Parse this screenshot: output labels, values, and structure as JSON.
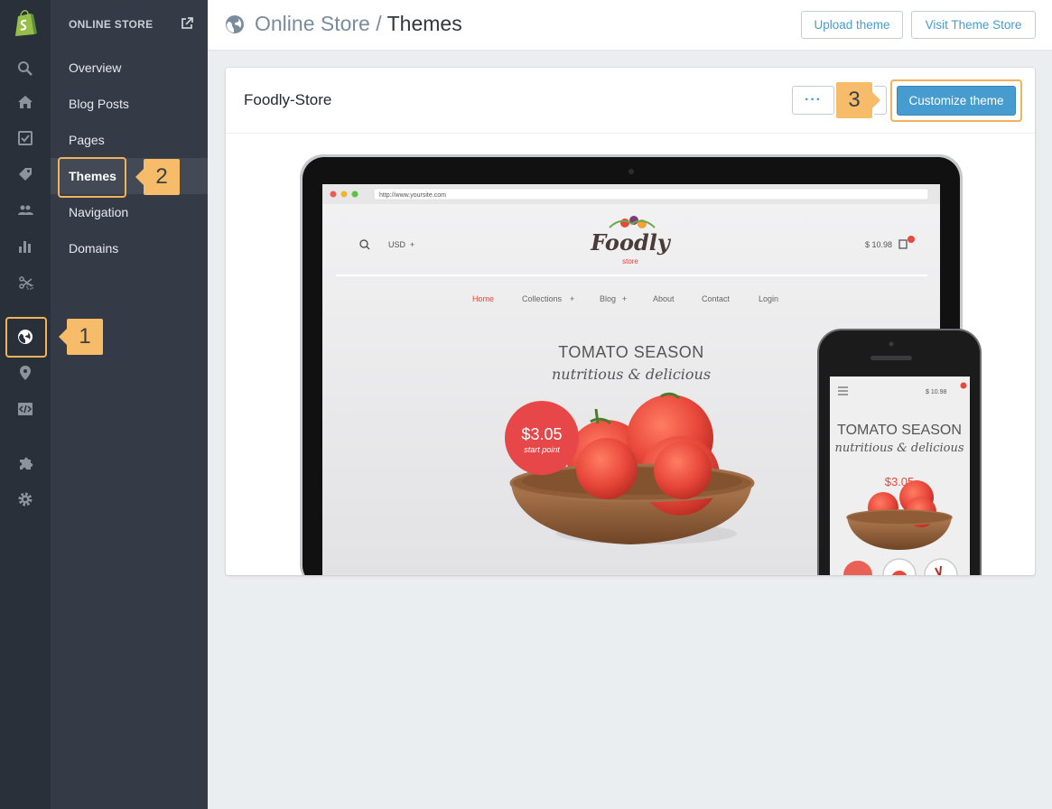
{
  "rail": {
    "icons": [
      "search-icon",
      "home-icon",
      "orders-icon",
      "products-icon",
      "customers-icon",
      "reports-icon",
      "discounts-icon",
      "online-store-icon",
      "location-icon",
      "code-icon",
      "apps-icon",
      "settings-icon"
    ]
  },
  "subnav": {
    "title": "ONLINE STORE",
    "items": [
      {
        "label": "Overview"
      },
      {
        "label": "Blog Posts"
      },
      {
        "label": "Pages"
      },
      {
        "label": "Themes",
        "active": true
      },
      {
        "label": "Navigation"
      },
      {
        "label": "Domains"
      }
    ]
  },
  "header": {
    "breadcrumb_parent": "Online Store",
    "separator": " / ",
    "title": "Themes",
    "upload_label": "Upload theme",
    "visit_label": "Visit Theme Store"
  },
  "theme": {
    "name": "Foodly-Store",
    "more_label": "···",
    "customize_label": "Customize theme"
  },
  "preview": {
    "url": "http://www.yoursite.com",
    "currency": "USD",
    "cart": "$ 10.98",
    "logo_main": "Foodly",
    "logo_sub": "store",
    "menu": [
      "Home",
      "Collections",
      "Blog",
      "About",
      "Contact",
      "Login"
    ],
    "hero_title": "TOMATO SEASON",
    "hero_sub": "nutritious & delicious",
    "price": "$3.05",
    "price_note": "start point",
    "mobile_cart": "$ 10.98",
    "mobile_price": "$3.05"
  },
  "callouts": [
    "1",
    "2",
    "3"
  ],
  "colors": {
    "accent": "#479ccf",
    "callout": "#f6bc6a",
    "rail": "#2a3039",
    "subnav": "#353b46",
    "tomato": "#e8473a"
  }
}
